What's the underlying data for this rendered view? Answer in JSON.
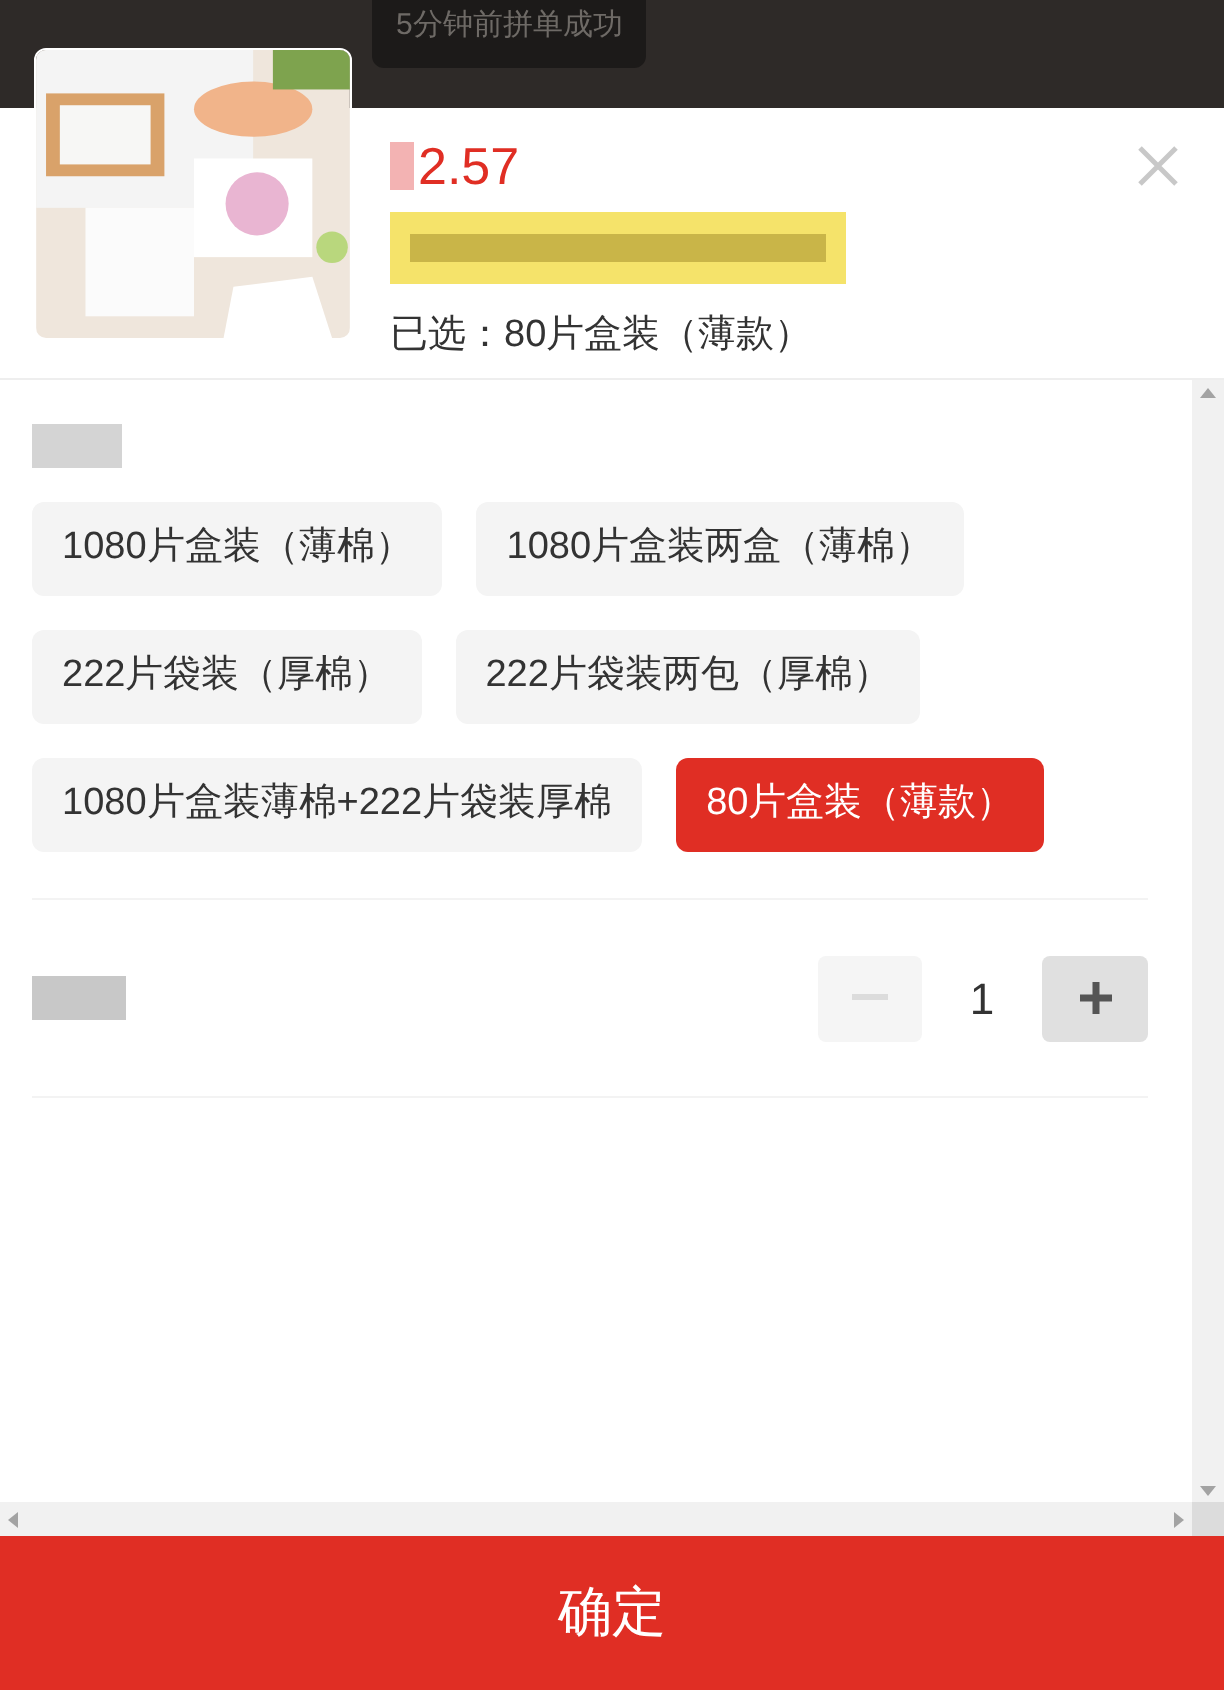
{
  "toast": {
    "text": "5分钟前拼单成功"
  },
  "product": {
    "price": "2.57",
    "selected_text": "已选：80片盒装（薄款）"
  },
  "options": [
    {
      "label": "1080片盒装（薄棉）",
      "selected": false
    },
    {
      "label": "1080片盒装两盒（薄棉）",
      "selected": false
    },
    {
      "label": "222片袋装（厚棉）",
      "selected": false
    },
    {
      "label": "222片袋装两包（厚棉）",
      "selected": false
    },
    {
      "label": "1080片盒装薄棉+222片袋装厚棉",
      "selected": false
    },
    {
      "label": "80片盒装（薄款）",
      "selected": true
    }
  ],
  "quantity": {
    "value": "1",
    "minus_disabled": true,
    "plus_disabled": false
  },
  "confirm_button": "确定"
}
